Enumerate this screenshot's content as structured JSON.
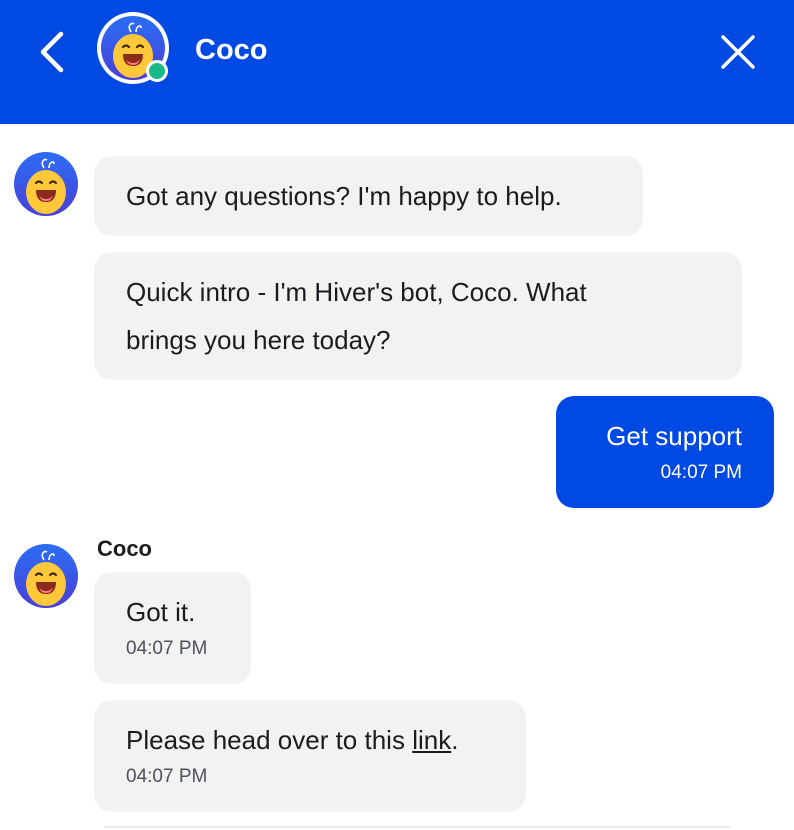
{
  "header": {
    "title": "Coco",
    "back_icon": "chevron-left-icon",
    "close_icon": "close-icon",
    "status": "online",
    "brand_color": "#0149e3",
    "online_color": "#19b98a"
  },
  "messages": [
    {
      "from": "bot",
      "text": "Got any questions? I'm happy to help."
    },
    {
      "from": "bot",
      "text_line1": "Quick intro - I'm Hiver's bot, Coco. What",
      "text_line2": "brings you here today?"
    },
    {
      "from": "user",
      "text": "Get support",
      "time": "04:07 PM"
    },
    {
      "from": "bot",
      "sender": "Coco",
      "text": "Got it.",
      "time": "04:07 PM"
    },
    {
      "from": "bot",
      "text_before": "Please head over to this ",
      "link_text": "link",
      "text_after": ".",
      "time": "04:07 PM"
    }
  ],
  "colors": {
    "bot_bubble": "#f3f2f0",
    "user_bubble": "#0149e3"
  }
}
